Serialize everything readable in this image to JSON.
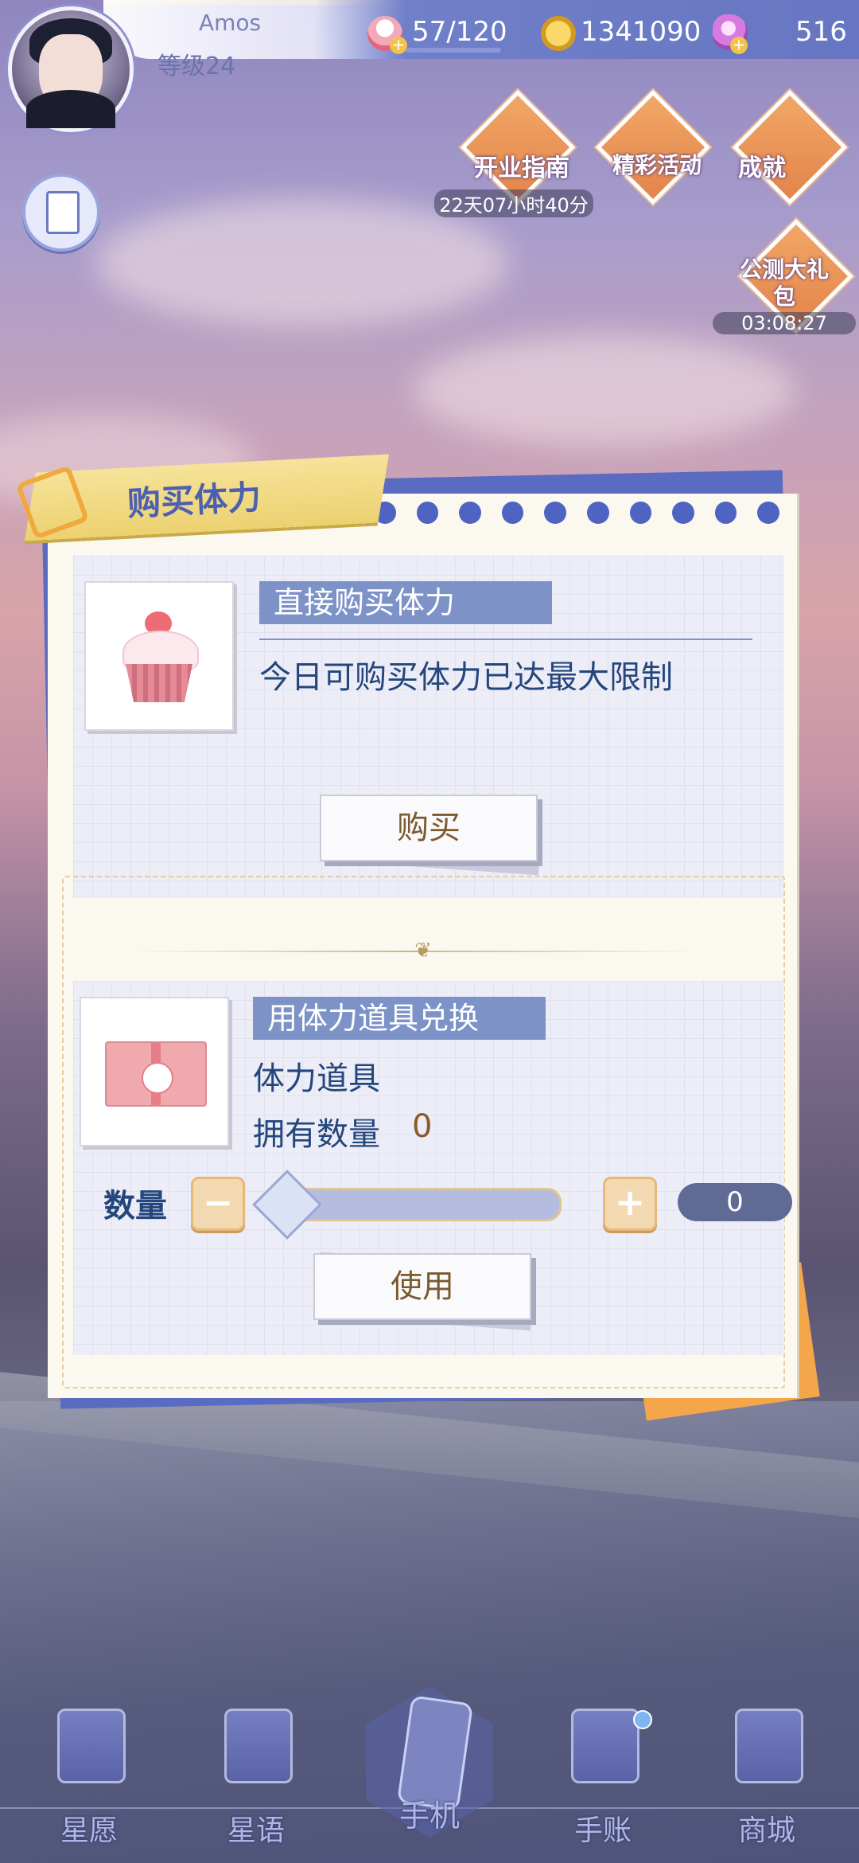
{
  "player": {
    "name": "Amos",
    "level": "等级24"
  },
  "resources": {
    "stamina": "57/120",
    "gold": "1341090",
    "gems": "516"
  },
  "events": [
    {
      "label": "开业指南",
      "timer": "22天07小时40分"
    },
    {
      "label": "精彩活动"
    },
    {
      "label": "成就"
    },
    {
      "label": "公测大礼包",
      "timer": "03:08:27"
    }
  ],
  "panel": {
    "title": "购买体力",
    "buy": {
      "section_label": "直接购买体力",
      "message": "今日可购买体力已达最大限制",
      "button": "购买"
    },
    "exchange": {
      "section_label": "用体力道具兑换",
      "item_name": "体力道具",
      "owned_label": "拥有数量",
      "owned_value": "0",
      "qty_label": "数量",
      "minus": "−",
      "plus": "+",
      "qty_value": "0",
      "slider_fraction": 0,
      "button": "使用"
    }
  },
  "nav": {
    "wish": "星愿",
    "star_talk": "星语",
    "phone": "手机",
    "journal": "手账",
    "shop": "商城"
  },
  "colors": {
    "accent": "#4f63c2",
    "button_text": "#7a5a2e",
    "body_text": "#24467c"
  }
}
